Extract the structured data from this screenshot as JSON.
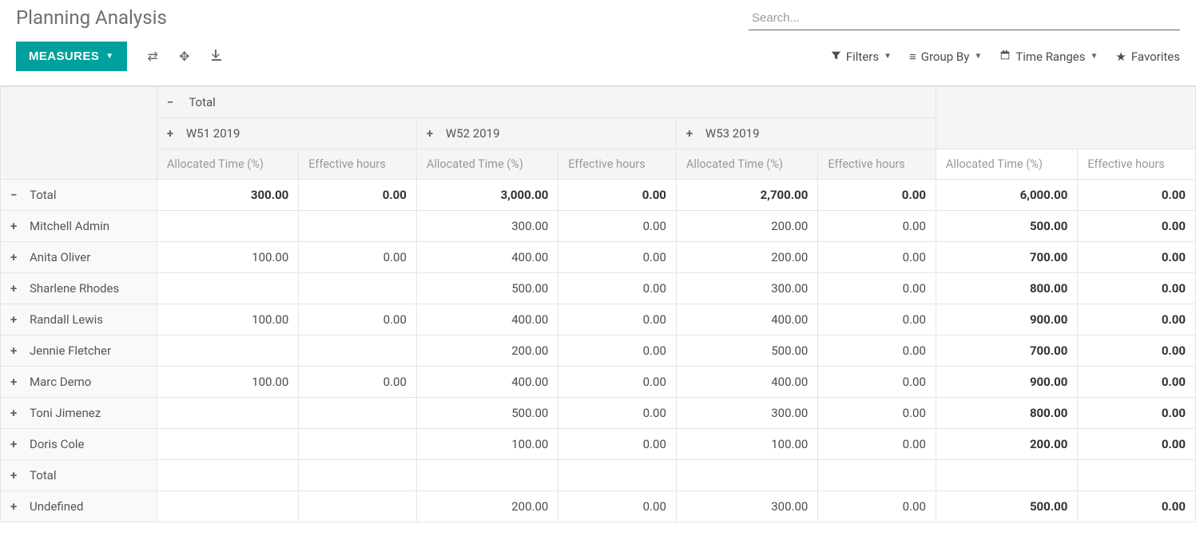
{
  "header": {
    "title": "Planning Analysis",
    "search_placeholder": "Search..."
  },
  "toolbar": {
    "measures_label": "MEASURES",
    "filters_label": "Filters",
    "groupby_label": "Group By",
    "timeranges_label": "Time Ranges",
    "favorites_label": "Favorites"
  },
  "pivot": {
    "total_label": "Total",
    "col_groups": [
      "W51 2019",
      "W52 2019",
      "W53 2019"
    ],
    "measures": [
      "Allocated Time (%)",
      "Effective hours"
    ],
    "row_total_label": "Total",
    "row_total_values": [
      "300.00",
      "0.00",
      "3,000.00",
      "0.00",
      "2,700.00",
      "0.00",
      "6,000.00",
      "0.00"
    ],
    "rows": [
      {
        "label": "Mitchell Admin",
        "cells": [
          "",
          "",
          "300.00",
          "0.00",
          "200.00",
          "0.00",
          "500.00",
          "0.00"
        ]
      },
      {
        "label": "Anita Oliver",
        "cells": [
          "100.00",
          "0.00",
          "400.00",
          "0.00",
          "200.00",
          "0.00",
          "700.00",
          "0.00"
        ]
      },
      {
        "label": "Sharlene Rhodes",
        "cells": [
          "",
          "",
          "500.00",
          "0.00",
          "300.00",
          "0.00",
          "800.00",
          "0.00"
        ]
      },
      {
        "label": "Randall Lewis",
        "cells": [
          "100.00",
          "0.00",
          "400.00",
          "0.00",
          "400.00",
          "0.00",
          "900.00",
          "0.00"
        ]
      },
      {
        "label": "Jennie Fletcher",
        "cells": [
          "",
          "",
          "200.00",
          "0.00",
          "500.00",
          "0.00",
          "700.00",
          "0.00"
        ]
      },
      {
        "label": "Marc Demo",
        "cells": [
          "100.00",
          "0.00",
          "400.00",
          "0.00",
          "400.00",
          "0.00",
          "900.00",
          "0.00"
        ]
      },
      {
        "label": "Toni Jimenez",
        "cells": [
          "",
          "",
          "500.00",
          "0.00",
          "300.00",
          "0.00",
          "800.00",
          "0.00"
        ]
      },
      {
        "label": "Doris Cole",
        "cells": [
          "",
          "",
          "100.00",
          "0.00",
          "100.00",
          "0.00",
          "200.00",
          "0.00"
        ]
      },
      {
        "label": "Total",
        "cells": [
          "",
          "",
          "",
          "",
          "",
          "",
          "",
          ""
        ]
      },
      {
        "label": "Undefined",
        "cells": [
          "",
          "",
          "200.00",
          "0.00",
          "300.00",
          "0.00",
          "500.00",
          "0.00"
        ]
      }
    ]
  }
}
